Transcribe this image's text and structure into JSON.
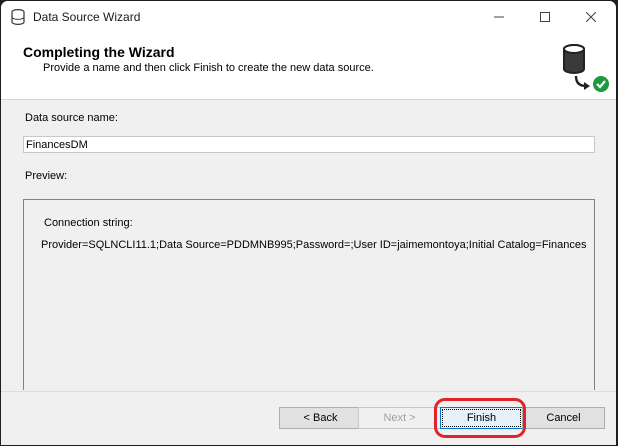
{
  "window": {
    "title": "Data Source Wizard",
    "icon": "database-icon",
    "controls": [
      "minimize-icon",
      "maximize-icon",
      "close-icon"
    ]
  },
  "header": {
    "title": "Completing the Wizard",
    "subtitle": "Provide a name and then click Finish to create the new data source.",
    "icon": "database-check-icon"
  },
  "form": {
    "name_label": "Data source name:",
    "name_value": "FinancesDM",
    "preview_label": "Preview:",
    "connection_label": "Connection string:",
    "connection_value": "Provider=SQLNCLI11.1;Data Source=PDDMNB995;Password=;User ID=jaimemontoya;Initial Catalog=Finances"
  },
  "buttons": {
    "back": "< Back",
    "next": "Next >",
    "finish": "Finish",
    "cancel": "Cancel"
  },
  "colors": {
    "highlight": "#e0242c",
    "check": "#1a9c3c",
    "focus_border": "#0078d7"
  }
}
